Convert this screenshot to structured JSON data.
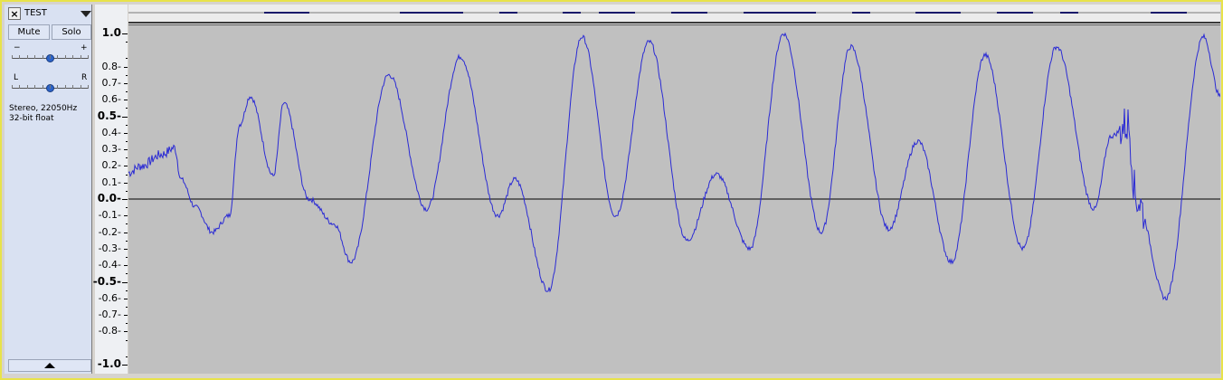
{
  "track": {
    "name": "TEST",
    "close_symbol": "×",
    "mute_label": "Mute",
    "solo_label": "Solo",
    "gain_min_label": "−",
    "gain_max_label": "+",
    "pan_left_label": "L",
    "pan_right_label": "R",
    "format_line1": "Stereo, 22050Hz",
    "format_line2": "32-bit float",
    "gain_value": 0.5,
    "pan_value": 0.5
  },
  "ruler": {
    "labels": [
      {
        "text": "1.0",
        "value": 1.0,
        "major": true
      },
      {
        "text": "0.8-",
        "value": 0.8,
        "major": false
      },
      {
        "text": "0.7-",
        "value": 0.7,
        "major": false
      },
      {
        "text": "0.6-",
        "value": 0.6,
        "major": false
      },
      {
        "text": "0.5-",
        "value": 0.5,
        "major": true
      },
      {
        "text": "0.4-",
        "value": 0.4,
        "major": false
      },
      {
        "text": "0.3-",
        "value": 0.3,
        "major": false
      },
      {
        "text": "0.2-",
        "value": 0.2,
        "major": false
      },
      {
        "text": "0.1-",
        "value": 0.1,
        "major": false
      },
      {
        "text": "0.0-",
        "value": 0.0,
        "major": true
      },
      {
        "text": "-0.1-",
        "value": -0.1,
        "major": false
      },
      {
        "text": "-0.2-",
        "value": -0.2,
        "major": false
      },
      {
        "text": "-0.3-",
        "value": -0.3,
        "major": false
      },
      {
        "text": "-0.4-",
        "value": -0.4,
        "major": false
      },
      {
        "text": "-0.5-",
        "value": -0.5,
        "major": true
      },
      {
        "text": "-0.6-",
        "value": -0.6,
        "major": false
      },
      {
        "text": "-0.7-",
        "value": -0.7,
        "major": false
      },
      {
        "text": "-0.8-",
        "value": -0.8,
        "major": false
      },
      {
        "text": "-1.0",
        "value": -1.0,
        "major": true
      }
    ]
  },
  "waveform": {
    "color": "#2a2ad4",
    "background": "#c0c0c0",
    "zero_line_color": "#000000",
    "envelope": [
      [
        0.0,
        0.16
      ],
      [
        0.03,
        0.2
      ],
      [
        0.08,
        0.27
      ],
      [
        0.11,
        0.31
      ],
      [
        0.125,
        0.12
      ],
      [
        0.16,
        -0.05
      ],
      [
        0.2,
        -0.2
      ],
      [
        0.24,
        -0.1
      ],
      [
        0.265,
        0.45
      ],
      [
        0.29,
        0.62
      ],
      [
        0.345,
        0.14
      ],
      [
        0.37,
        0.58
      ],
      [
        0.43,
        0.0
      ],
      [
        0.49,
        -0.15
      ],
      [
        0.53,
        -0.38
      ],
      [
        0.62,
        0.75
      ],
      [
        0.71,
        -0.06
      ],
      [
        0.79,
        0.86
      ],
      [
        0.88,
        -0.1
      ],
      [
        0.92,
        0.12
      ],
      [
        1.0,
        -0.55
      ],
      [
        1.08,
        0.98
      ],
      [
        1.16,
        -0.1
      ],
      [
        1.24,
        0.95
      ],
      [
        1.33,
        -0.25
      ],
      [
        1.4,
        0.15
      ],
      [
        1.48,
        -0.3
      ],
      [
        1.56,
        1.0
      ],
      [
        1.65,
        -0.2
      ],
      [
        1.72,
        0.92
      ],
      [
        1.81,
        -0.18
      ],
      [
        1.88,
        0.35
      ],
      [
        1.96,
        -0.38
      ],
      [
        2.04,
        0.87
      ],
      [
        2.13,
        -0.3
      ],
      [
        2.21,
        0.92
      ],
      [
        2.3,
        -0.06
      ],
      [
        2.34,
        0.38
      ],
      [
        2.38,
        0.45
      ],
      [
        2.4,
        0.0
      ],
      [
        2.47,
        -0.6
      ],
      [
        2.56,
        0.98
      ],
      [
        2.6,
        0.62
      ]
    ]
  }
}
